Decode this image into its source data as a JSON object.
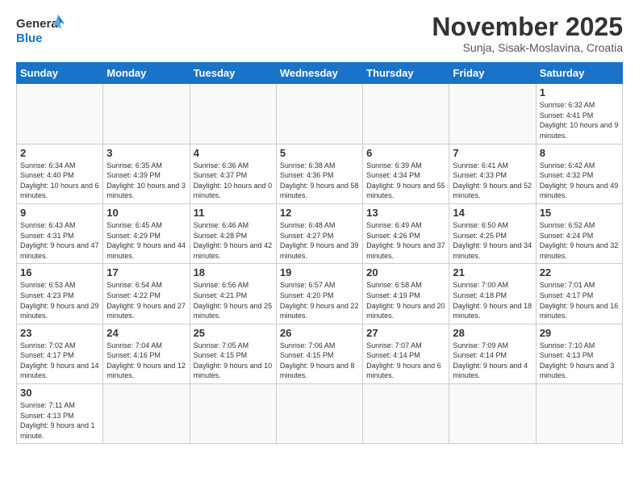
{
  "header": {
    "logo_general": "General",
    "logo_blue": "Blue",
    "month_title": "November 2025",
    "subtitle": "Sunja, Sisak-Moslavina, Croatia"
  },
  "weekdays": [
    "Sunday",
    "Monday",
    "Tuesday",
    "Wednesday",
    "Thursday",
    "Friday",
    "Saturday"
  ],
  "weeks": [
    [
      {
        "day": "",
        "info": ""
      },
      {
        "day": "",
        "info": ""
      },
      {
        "day": "",
        "info": ""
      },
      {
        "day": "",
        "info": ""
      },
      {
        "day": "",
        "info": ""
      },
      {
        "day": "",
        "info": ""
      },
      {
        "day": "1",
        "info": "Sunrise: 6:32 AM\nSunset: 4:41 PM\nDaylight: 10 hours and 9 minutes."
      }
    ],
    [
      {
        "day": "2",
        "info": "Sunrise: 6:34 AM\nSunset: 4:40 PM\nDaylight: 10 hours and 6 minutes."
      },
      {
        "day": "3",
        "info": "Sunrise: 6:35 AM\nSunset: 4:39 PM\nDaylight: 10 hours and 3 minutes."
      },
      {
        "day": "4",
        "info": "Sunrise: 6:36 AM\nSunset: 4:37 PM\nDaylight: 10 hours and 0 minutes."
      },
      {
        "day": "5",
        "info": "Sunrise: 6:38 AM\nSunset: 4:36 PM\nDaylight: 9 hours and 58 minutes."
      },
      {
        "day": "6",
        "info": "Sunrise: 6:39 AM\nSunset: 4:34 PM\nDaylight: 9 hours and 55 minutes."
      },
      {
        "day": "7",
        "info": "Sunrise: 6:41 AM\nSunset: 4:33 PM\nDaylight: 9 hours and 52 minutes."
      },
      {
        "day": "8",
        "info": "Sunrise: 6:42 AM\nSunset: 4:32 PM\nDaylight: 9 hours and 49 minutes."
      }
    ],
    [
      {
        "day": "9",
        "info": "Sunrise: 6:43 AM\nSunset: 4:31 PM\nDaylight: 9 hours and 47 minutes."
      },
      {
        "day": "10",
        "info": "Sunrise: 6:45 AM\nSunset: 4:29 PM\nDaylight: 9 hours and 44 minutes."
      },
      {
        "day": "11",
        "info": "Sunrise: 6:46 AM\nSunset: 4:28 PM\nDaylight: 9 hours and 42 minutes."
      },
      {
        "day": "12",
        "info": "Sunrise: 6:48 AM\nSunset: 4:27 PM\nDaylight: 9 hours and 39 minutes."
      },
      {
        "day": "13",
        "info": "Sunrise: 6:49 AM\nSunset: 4:26 PM\nDaylight: 9 hours and 37 minutes."
      },
      {
        "day": "14",
        "info": "Sunrise: 6:50 AM\nSunset: 4:25 PM\nDaylight: 9 hours and 34 minutes."
      },
      {
        "day": "15",
        "info": "Sunrise: 6:52 AM\nSunset: 4:24 PM\nDaylight: 9 hours and 32 minutes."
      }
    ],
    [
      {
        "day": "16",
        "info": "Sunrise: 6:53 AM\nSunset: 4:23 PM\nDaylight: 9 hours and 29 minutes."
      },
      {
        "day": "17",
        "info": "Sunrise: 6:54 AM\nSunset: 4:22 PM\nDaylight: 9 hours and 27 minutes."
      },
      {
        "day": "18",
        "info": "Sunrise: 6:56 AM\nSunset: 4:21 PM\nDaylight: 9 hours and 25 minutes."
      },
      {
        "day": "19",
        "info": "Sunrise: 6:57 AM\nSunset: 4:20 PM\nDaylight: 9 hours and 22 minutes."
      },
      {
        "day": "20",
        "info": "Sunrise: 6:58 AM\nSunset: 4:19 PM\nDaylight: 9 hours and 20 minutes."
      },
      {
        "day": "21",
        "info": "Sunrise: 7:00 AM\nSunset: 4:18 PM\nDaylight: 9 hours and 18 minutes."
      },
      {
        "day": "22",
        "info": "Sunrise: 7:01 AM\nSunset: 4:17 PM\nDaylight: 9 hours and 16 minutes."
      }
    ],
    [
      {
        "day": "23",
        "info": "Sunrise: 7:02 AM\nSunset: 4:17 PM\nDaylight: 9 hours and 14 minutes."
      },
      {
        "day": "24",
        "info": "Sunrise: 7:04 AM\nSunset: 4:16 PM\nDaylight: 9 hours and 12 minutes."
      },
      {
        "day": "25",
        "info": "Sunrise: 7:05 AM\nSunset: 4:15 PM\nDaylight: 9 hours and 10 minutes."
      },
      {
        "day": "26",
        "info": "Sunrise: 7:06 AM\nSunset: 4:15 PM\nDaylight: 9 hours and 8 minutes."
      },
      {
        "day": "27",
        "info": "Sunrise: 7:07 AM\nSunset: 4:14 PM\nDaylight: 9 hours and 6 minutes."
      },
      {
        "day": "28",
        "info": "Sunrise: 7:09 AM\nSunset: 4:14 PM\nDaylight: 9 hours and 4 minutes."
      },
      {
        "day": "29",
        "info": "Sunrise: 7:10 AM\nSunset: 4:13 PM\nDaylight: 9 hours and 3 minutes."
      }
    ],
    [
      {
        "day": "30",
        "info": "Sunrise: 7:11 AM\nSunset: 4:13 PM\nDaylight: 9 hours and 1 minute."
      },
      {
        "day": "",
        "info": ""
      },
      {
        "day": "",
        "info": ""
      },
      {
        "day": "",
        "info": ""
      },
      {
        "day": "",
        "info": ""
      },
      {
        "day": "",
        "info": ""
      },
      {
        "day": "",
        "info": ""
      }
    ]
  ]
}
